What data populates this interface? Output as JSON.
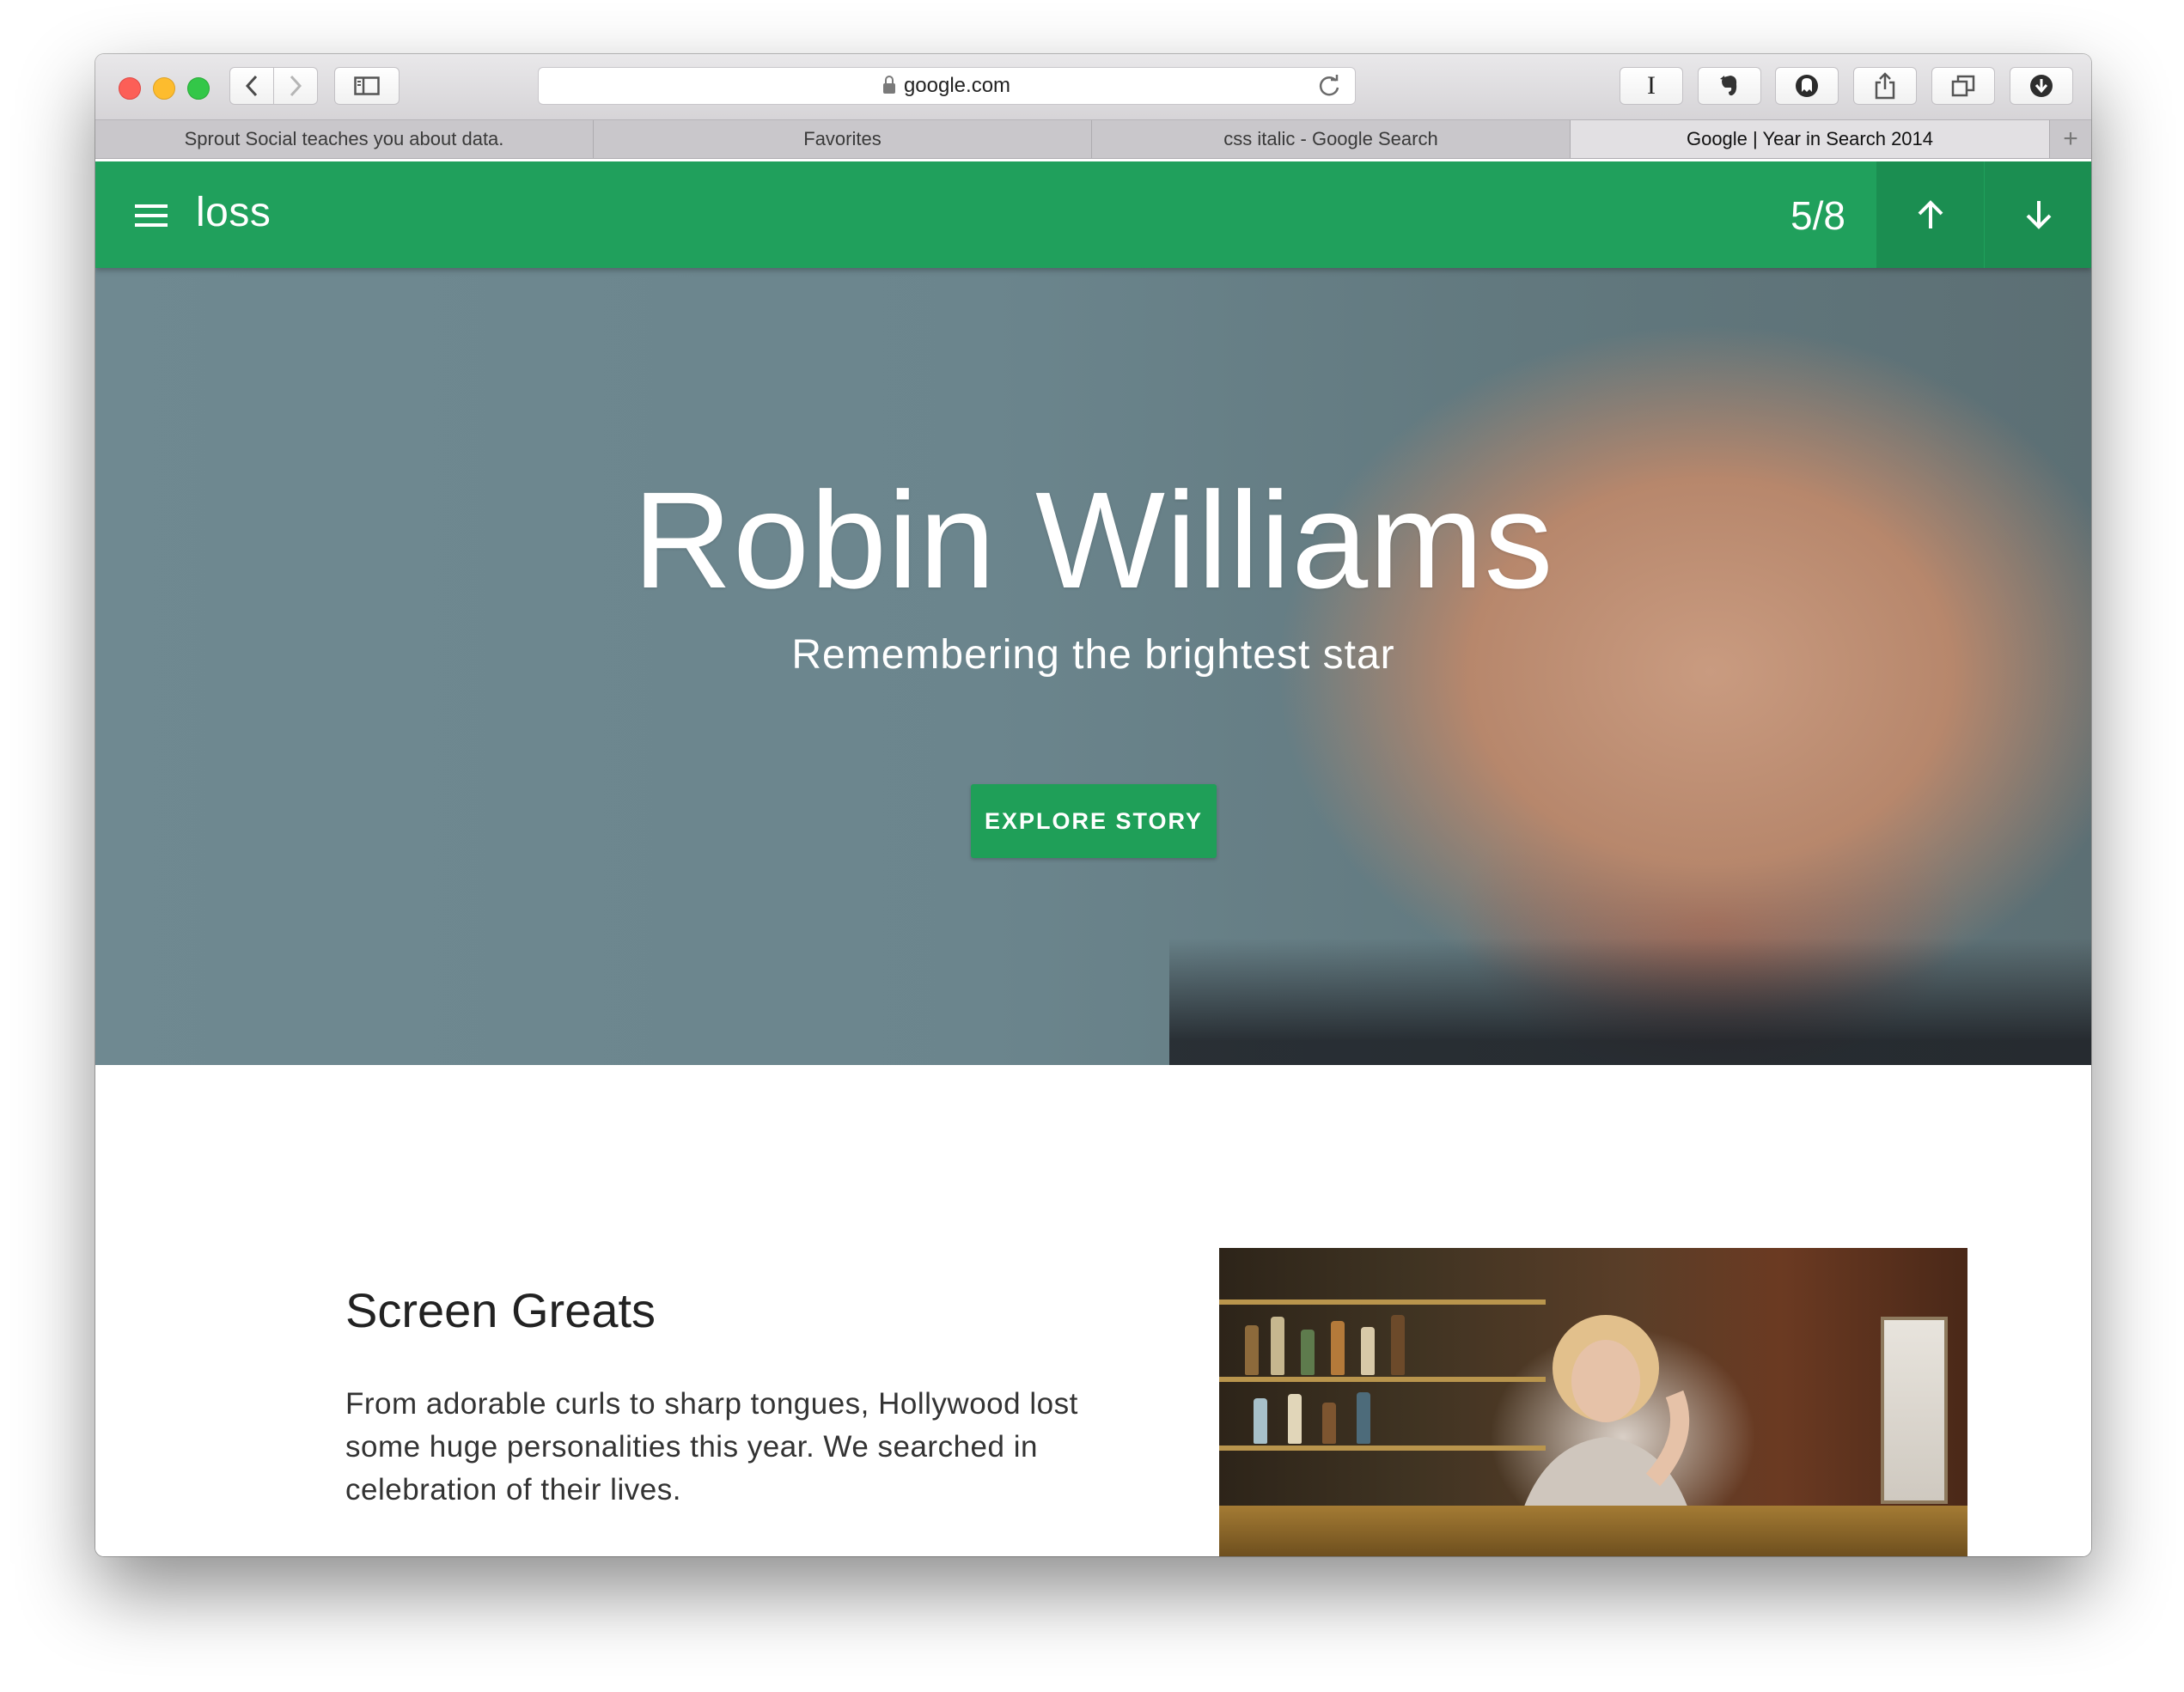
{
  "browser": {
    "url": "google.com",
    "tabs": [
      {
        "label": "Sprout Social teaches you about data.",
        "active": false
      },
      {
        "label": "Favorites",
        "active": false
      },
      {
        "label": "css italic - Google Search",
        "active": false
      },
      {
        "label": "Google | Year in Search 2014",
        "active": true
      }
    ],
    "new_tab_symbol": "+"
  },
  "icons": {
    "back": "chevron-left-icon",
    "forward": "chevron-right-icon",
    "sidebar": "sidebar-icon",
    "reload": "reload-icon",
    "lock": "lock-icon",
    "extension_1": "instapaper-icon",
    "extension_2": "evernote-icon",
    "extension_3": "ghostery-icon",
    "share": "share-icon",
    "tabs_overview": "tabs-overview-icon",
    "downloads": "download-icon",
    "menu": "hamburger-menu-icon",
    "up": "arrow-up-icon",
    "down": "arrow-down-icon"
  },
  "extensions": {
    "instapaper_glyph": "I"
  },
  "appbar": {
    "title": "loss",
    "counter": "5/8"
  },
  "hero": {
    "title": "Robin Williams",
    "subtitle": "Remembering the brightest star",
    "button_label": "EXPLORE STORY"
  },
  "section": {
    "title": "Screen Greats",
    "body": "From adorable curls to sharp tongues, Hollywood lost some huge personalities this year. We searched in celebration of their lives."
  },
  "colors": {
    "brand_green": "#20a05c",
    "brand_green_dark": "#1b8e51",
    "button_green": "#1f9f58"
  }
}
